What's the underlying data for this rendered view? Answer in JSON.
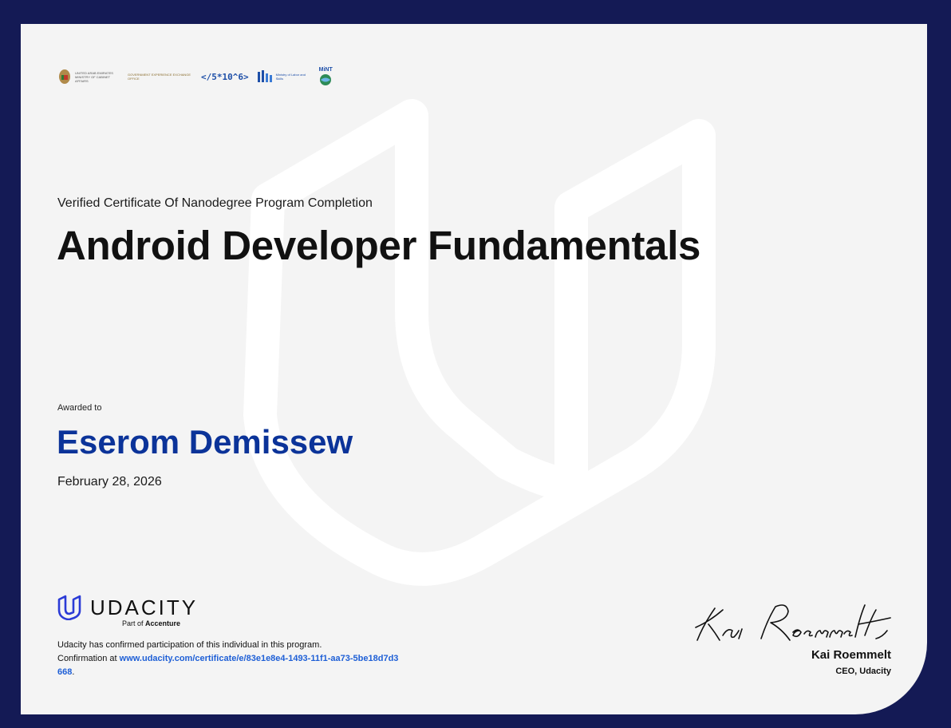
{
  "logos": [
    {
      "name": "uae-ministry-of-cabinet-affairs",
      "text": "UNITED ARAB EMIRATES MINISTRY OF CABINET AFFAIRS"
    },
    {
      "name": "government-experience-exchange-office",
      "text": "GOVERNMENT EXPERIENCE EXCHANGE OFFICE"
    },
    {
      "name": "5-million-ethiopian-coders",
      "text": "</5*10^6>"
    },
    {
      "name": "ministry-of-labor-and-skills",
      "text": "Ministry of Labor and Skills"
    },
    {
      "name": "mint-ethiopia",
      "text": "MiNT"
    }
  ],
  "certificate": {
    "subtitle": "Verified Certificate Of Nanodegree Program Completion",
    "title": "Android Developer Fundamentals",
    "awarded_label": "Awarded to",
    "recipient": "Eserom Demissew",
    "date": "February 28, 2026"
  },
  "brand": {
    "name": "UDACITY",
    "part_of_prefix": "Part of",
    "part_of_company": "Accenture",
    "icon": "udacity-u-logo"
  },
  "confirmation": {
    "text": "Udacity has confirmed participation of this individual in this program.",
    "prefix": "Confirmation at",
    "url": "www.udacity.com/certificate/e/83e1e8e4-1493-11f1-aa73-5be18d7d3668",
    "suffix": "."
  },
  "signature": {
    "script": "Kai Roemmelt",
    "name": "Kai Roemmelt",
    "role": "CEO, Udacity"
  },
  "colors": {
    "frame": "#141a55",
    "card": "#f4f4f4",
    "recipient": "#0b3399",
    "link": "#1e5fd6",
    "udacity_blue": "#2b3bd6"
  }
}
